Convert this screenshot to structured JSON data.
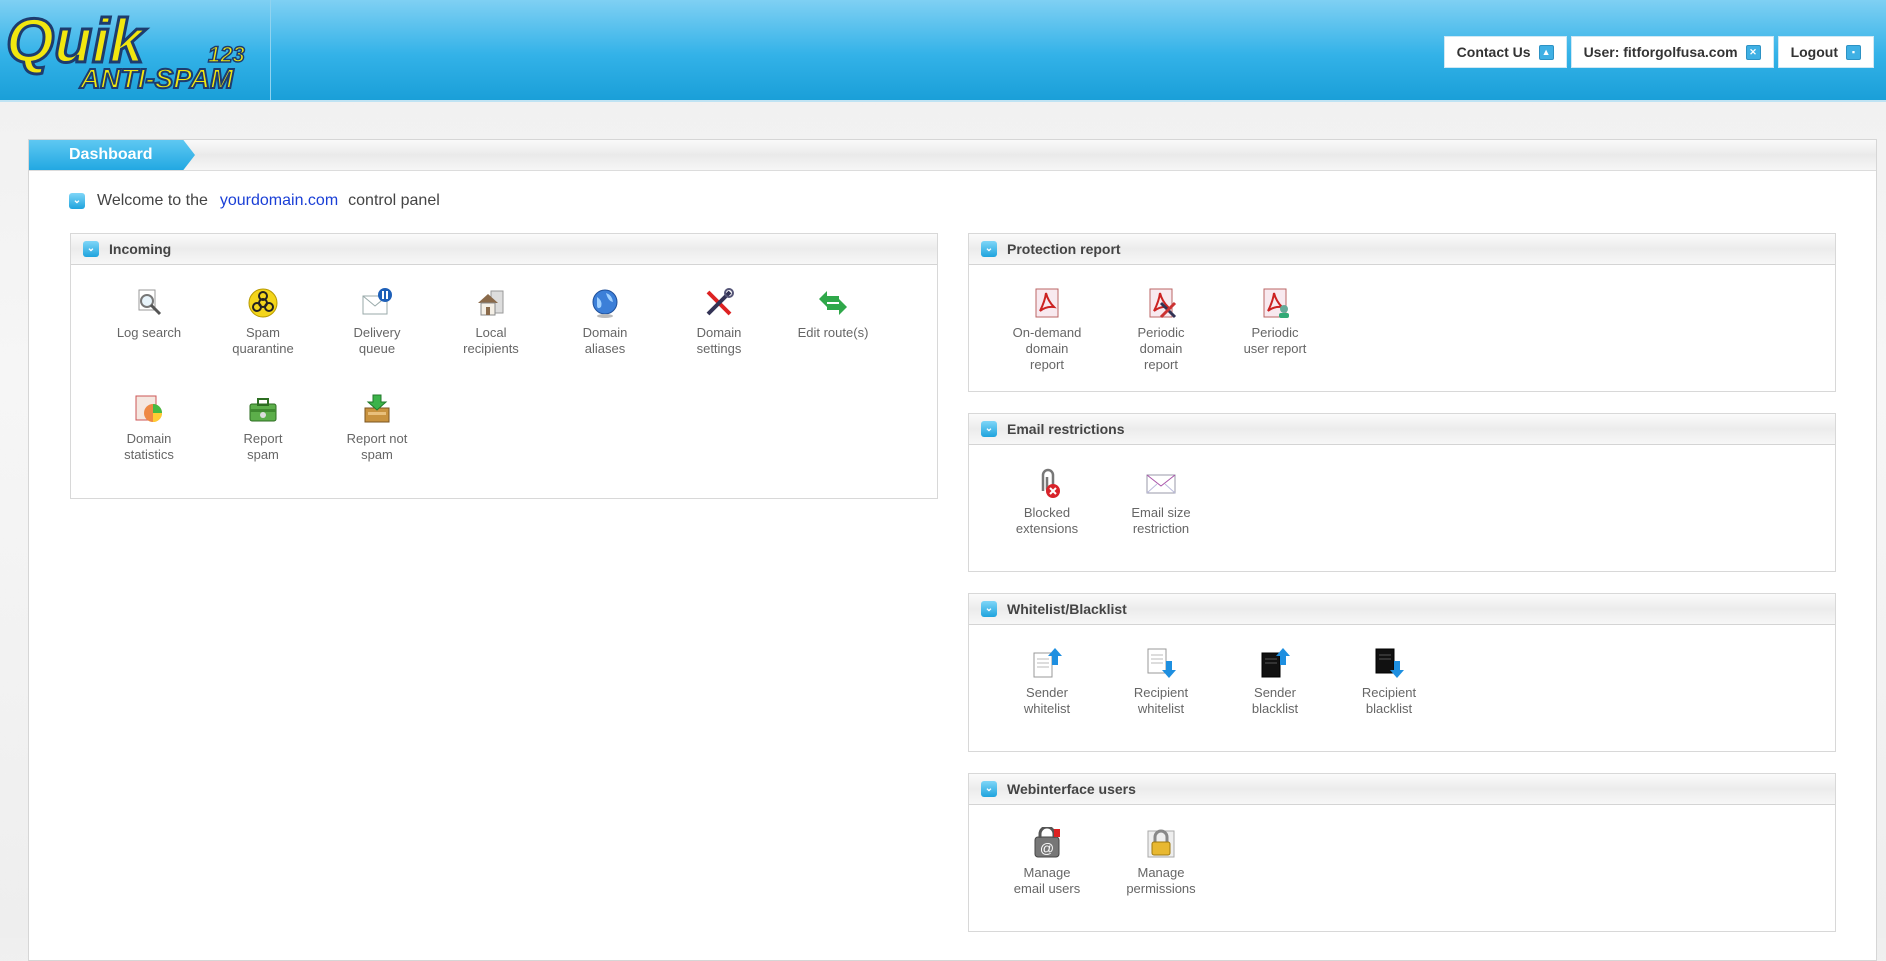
{
  "logo": {
    "line1": "Quik",
    "line2": "ANTI-SPAM",
    "badge": "123"
  },
  "topnav": {
    "contact": "Contact Us",
    "user": "User: fitforgolfusa.com",
    "logout": "Logout"
  },
  "tab": {
    "dashboard": "Dashboard"
  },
  "welcome": {
    "prefix": "Welcome to the",
    "domain": "yourdomain.com",
    "suffix": "control panel"
  },
  "incoming": {
    "title": "Incoming",
    "items": [
      {
        "label": "Log search",
        "icon": "magnifier-icon"
      },
      {
        "label": "Spam\nquarantine",
        "icon": "biohazard-icon"
      },
      {
        "label": "Delivery\nqueue",
        "icon": "mail-pause-icon"
      },
      {
        "label": "Local\nrecipients",
        "icon": "house-icon"
      },
      {
        "label": "Domain\naliases",
        "icon": "globe-icon"
      },
      {
        "label": "Domain\nsettings",
        "icon": "tools-icon"
      },
      {
        "label": "Edit route(s)",
        "icon": "route-arrows-icon"
      },
      {
        "label": "Domain\nstatistics",
        "icon": "pie-chart-icon"
      },
      {
        "label": "Report\nspam",
        "icon": "toolbox-icon"
      },
      {
        "label": "Report not\nspam",
        "icon": "inbox-down-icon"
      }
    ]
  },
  "protection": {
    "title": "Protection report",
    "items": [
      {
        "label": "On-demand\ndomain\nreport",
        "icon": "pdf-icon"
      },
      {
        "label": "Periodic\ndomain\nreport",
        "icon": "pdf-tools-icon"
      },
      {
        "label": "Periodic\nuser report",
        "icon": "pdf-user-icon"
      }
    ]
  },
  "restrictions": {
    "title": "Email restrictions",
    "items": [
      {
        "label": "Blocked\nextensions",
        "icon": "paperclip-blocked-icon"
      },
      {
        "label": "Email size\nrestriction",
        "icon": "envelope-icon"
      }
    ]
  },
  "lists": {
    "title": "Whitelist/Blacklist",
    "items": [
      {
        "label": "Sender\nwhitelist",
        "icon": "doc-up-white-icon"
      },
      {
        "label": "Recipient\nwhitelist",
        "icon": "doc-down-white-icon"
      },
      {
        "label": "Sender\nblacklist",
        "icon": "doc-up-black-icon"
      },
      {
        "label": "Recipient\nblacklist",
        "icon": "doc-down-black-icon"
      }
    ]
  },
  "webusers": {
    "title": "Webinterface users",
    "items": [
      {
        "label": "Manage\nemail users",
        "icon": "at-lock-icon"
      },
      {
        "label": "Manage\npermissions",
        "icon": "padlock-icon"
      }
    ]
  }
}
